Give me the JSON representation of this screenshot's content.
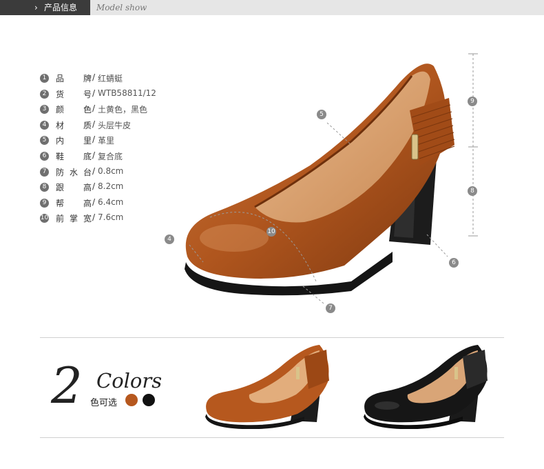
{
  "header": {
    "chevron": "›",
    "title": "产品信息",
    "subtitle": "Model show"
  },
  "specs": [
    {
      "num": "1",
      "label": "品牌",
      "value": "红蜻蜓"
    },
    {
      "num": "2",
      "label": "货号",
      "value": "WTB58811/12"
    },
    {
      "num": "3",
      "label": "颜色",
      "value": "土黄色，黑色"
    },
    {
      "num": "4",
      "label": "材质",
      "value": "头层牛皮"
    },
    {
      "num": "5",
      "label": "内里",
      "value": "革里"
    },
    {
      "num": "6",
      "label": "鞋底",
      "value": "复合底"
    },
    {
      "num": "7",
      "label": "防水台",
      "value": "0.8cm"
    },
    {
      "num": "8",
      "label": "跟高",
      "value": "8.2cm"
    },
    {
      "num": "9",
      "label": "帮高",
      "value": "6.4cm"
    },
    {
      "num": "10",
      "label": "前掌宽",
      "value": "7.6cm"
    }
  ],
  "slash": "/",
  "callouts": {
    "c4": "4",
    "c5": "5",
    "c6": "6",
    "c7": "7",
    "c8": "8",
    "c9": "9",
    "c10": "10"
  },
  "colors_section": {
    "big_number": "2",
    "word": "Colors",
    "chinese": "色可选",
    "swatches": [
      "#b6581e",
      "#111111"
    ]
  },
  "palette": {
    "brown": "#b6581e",
    "brown_dark": "#8a3f12",
    "black": "#111111"
  }
}
